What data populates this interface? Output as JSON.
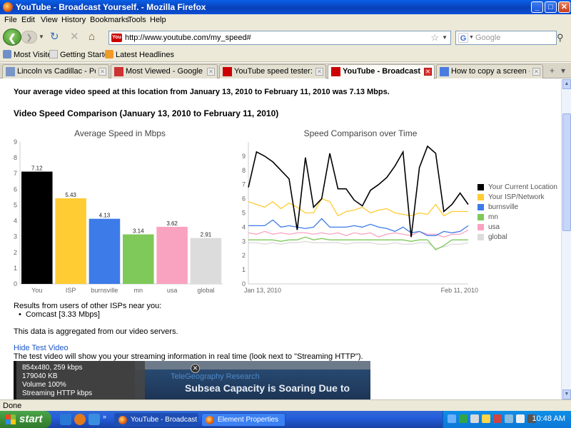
{
  "window": {
    "title": "YouTube - Broadcast Yourself. - Mozilla Firefox",
    "controls": {
      "minimize": "_",
      "maximize": "□",
      "close": "✕"
    }
  },
  "menu": [
    "File",
    "Edit",
    "View",
    "History",
    "Bookmarks",
    "Tools",
    "Help"
  ],
  "nav": {
    "url": "http://www.youtube.com/my_speed#",
    "search_placeholder": "Google"
  },
  "bookmarks": [
    "Most Visited",
    "Getting Started",
    "Latest Headlines"
  ],
  "tabs": [
    {
      "label": "Lincoln vs Cadillac - Post Ne...",
      "active": false
    },
    {
      "label": "Most Viewed - Google Fast ...",
      "active": false
    },
    {
      "label": "YouTube speed tester: Net ...",
      "active": false
    },
    {
      "label": "YouTube - Broadcast Y...",
      "active": true
    },
    {
      "label": "How to copy a screen - Goo...",
      "active": false
    }
  ],
  "page": {
    "headline": "Your average video speed at this location from January 13, 2010 to February 11, 2010 was 7.13 Mbps.",
    "section_title": "Video Speed Comparison (January 13, 2010 to February 11, 2010)",
    "results_intro": "Results from users of other ISPs near you:",
    "isp_item": "Comcast [3.33 Mbps]",
    "aggregated_note": "This data is aggregated from our video servers.",
    "hide_link": "Hide Test Video",
    "test_note": "The test video will show you your streaming information in real time (look next to \"Streaming HTTP\").",
    "video": {
      "lines": [
        "854x480, 259 kbps",
        "179040 KB",
        "Volume 100%",
        "Streaming HTTP     kbps"
      ],
      "screen_text_1": "TeleGeography Research",
      "screen_text_2": "Subsea Capacity is Soaring Due to"
    }
  },
  "chart_data": [
    {
      "type": "bar",
      "title": "Average Speed in Mbps",
      "categories": [
        "You",
        "ISP",
        "burnsville",
        "mn",
        "usa",
        "global"
      ],
      "values": [
        7.12,
        5.43,
        4.13,
        3.14,
        3.62,
        2.91
      ],
      "data_labels": [
        "7.12",
        "5.43",
        "4.13",
        "3.14",
        "3.62",
        "2.91"
      ],
      "colors": [
        "#000000",
        "#ffcc33",
        "#3d7be8",
        "#7ec95a",
        "#f9a3c1",
        "#dcdcdc"
      ],
      "ylim": [
        0,
        9
      ],
      "yticks": [
        "0",
        "1",
        "2",
        "3",
        "4",
        "5",
        "6",
        "7",
        "8",
        "9"
      ],
      "legend": "none"
    },
    {
      "type": "line",
      "title": "Speed Comparison over Time",
      "x_labels": [
        "Jan 13, 2010",
        "Feb 11, 2010"
      ],
      "ylim": [
        0,
        10
      ],
      "yticks": [
        "0",
        "1",
        "2",
        "3",
        "4",
        "5",
        "6",
        "7",
        "8",
        "9"
      ],
      "legend": "right",
      "series": [
        {
          "name": "Your Current Location",
          "color": "#000000",
          "values": [
            6.8,
            9.3,
            9.0,
            8.6,
            8.0,
            7.4,
            3.8,
            8.9,
            5.4,
            6.0,
            9.2,
            6.7,
            6.7,
            5.9,
            5.5,
            6.6,
            7.0,
            7.5,
            8.3,
            9.3,
            3.3,
            8.2,
            9.7,
            9.2,
            5.1,
            5.6,
            6.4,
            5.6
          ]
        },
        {
          "name": "Your ISP/Network",
          "color": "#ffcc33",
          "values": [
            5.8,
            5.6,
            5.4,
            5.8,
            5.3,
            5.7,
            5.4,
            5.0,
            5.0,
            6.0,
            5.8,
            4.8,
            5.1,
            5.2,
            5.4,
            5.0,
            5.2,
            5.3,
            5.0,
            4.9,
            4.8,
            5.0,
            4.9,
            5.6,
            4.8,
            5.1,
            5.1,
            5.1
          ]
        },
        {
          "name": "burnsville",
          "color": "#3d7be8",
          "values": [
            4.1,
            4.1,
            4.1,
            4.5,
            4.0,
            4.1,
            4.0,
            3.9,
            4.0,
            4.6,
            4.0,
            4.0,
            4.0,
            4.1,
            4.0,
            4.2,
            4.0,
            3.9,
            3.7,
            4.0,
            3.6,
            3.7,
            3.4,
            3.4,
            3.7,
            3.6,
            3.7,
            4.1
          ]
        },
        {
          "name": "mn",
          "color": "#7ec95a",
          "values": [
            3.1,
            3.1,
            3.1,
            3.1,
            3.0,
            3.1,
            3.1,
            3.3,
            3.1,
            3.2,
            3.1,
            3.1,
            3.1,
            3.1,
            3.1,
            3.1,
            3.1,
            3.1,
            3.1,
            3.1,
            3.0,
            3.1,
            3.1,
            2.4,
            2.7,
            3.1,
            3.1,
            3.1
          ]
        },
        {
          "name": "usa",
          "color": "#f9a3c1",
          "values": [
            3.6,
            3.5,
            3.7,
            3.5,
            3.6,
            3.5,
            3.6,
            3.6,
            3.5,
            3.6,
            3.5,
            3.6,
            3.4,
            3.6,
            3.5,
            3.6,
            3.3,
            3.5,
            3.6,
            3.5,
            3.4,
            3.7,
            3.5,
            3.5,
            3.3,
            3.5,
            3.5,
            3.8
          ]
        },
        {
          "name": "global",
          "color": "#dcdcdc",
          "values": [
            2.9,
            2.9,
            2.8,
            2.9,
            2.8,
            2.9,
            2.9,
            3.0,
            2.9,
            2.9,
            2.9,
            2.9,
            2.8,
            2.9,
            2.9,
            2.9,
            2.8,
            2.8,
            2.9,
            2.8,
            2.8,
            2.9,
            2.9,
            2.5,
            2.6,
            2.8,
            2.8,
            2.9
          ]
        }
      ]
    }
  ],
  "status": "Done",
  "taskbar": {
    "start": "start",
    "tasks": [
      {
        "label": "YouTube - Broadcast ...",
        "active": true
      },
      {
        "label": "Element Properties",
        "active": false
      }
    ],
    "clock": "10:48 AM"
  }
}
